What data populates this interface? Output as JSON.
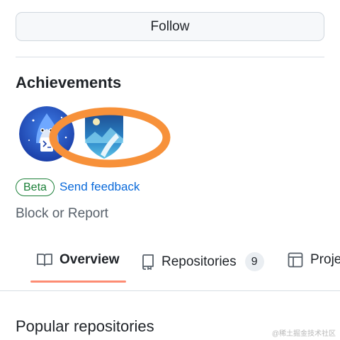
{
  "follow_button": {
    "label": "Follow"
  },
  "achievements": {
    "title": "Achievements",
    "badges": [
      {
        "name": "shark-badge-icon"
      },
      {
        "name": "mountain-shield-badge-icon"
      }
    ],
    "beta_label": "Beta",
    "feedback_link": "Send feedback"
  },
  "block_report": "Block or Report",
  "tabs": [
    {
      "label": "Overview",
      "icon": "book-icon",
      "selected": true
    },
    {
      "label": "Repositories",
      "icon": "repo-icon",
      "count": "9"
    },
    {
      "label": "Proje",
      "icon": "table-icon"
    }
  ],
  "popular_repositories": "Popular repositories",
  "watermark": "@稀土掘金技术社区",
  "colors": {
    "tab_underline": "#fd8c73",
    "link": "#0969da",
    "beta": "#1a7f37",
    "annotation": "#f7913a"
  }
}
